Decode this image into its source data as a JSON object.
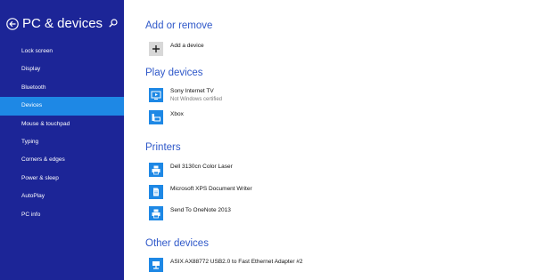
{
  "sidebar": {
    "title": "PC & devices",
    "items": [
      {
        "label": "Lock screen"
      },
      {
        "label": "Display"
      },
      {
        "label": "Bluetooth"
      },
      {
        "label": "Devices",
        "active": true
      },
      {
        "label": "Mouse & touchpad"
      },
      {
        "label": "Typing"
      },
      {
        "label": "Corners & edges"
      },
      {
        "label": "Power & sleep"
      },
      {
        "label": "AutoPlay"
      },
      {
        "label": "PC info"
      }
    ]
  },
  "main": {
    "add_section": {
      "title": "Add or remove",
      "add_label": "Add a device"
    },
    "play_devices": {
      "title": "Play devices",
      "items": [
        {
          "name": "Sony Internet TV",
          "status": "Not Windows certified",
          "icon": "tv-icon"
        },
        {
          "name": "Xbox",
          "icon": "xbox-icon"
        }
      ]
    },
    "printers": {
      "title": "Printers",
      "items": [
        {
          "name": "Dell 3130cn Color Laser",
          "icon": "printer-icon"
        },
        {
          "name": "Microsoft XPS Document Writer",
          "icon": "document-printer-icon"
        },
        {
          "name": "Send To OneNote 2013",
          "icon": "printer-icon"
        }
      ]
    },
    "other_devices": {
      "title": "Other devices",
      "items": [
        {
          "name": "ASIX AX88772 USB2.0 to Fast Ethernet Adapter #2",
          "icon": "network-adapter-icon"
        }
      ]
    }
  },
  "colors": {
    "sidebar_bg": "#1c2597",
    "active_item": "#1e88e5",
    "section_title": "#2f58c9",
    "tile_blue": "#1e88e5"
  }
}
